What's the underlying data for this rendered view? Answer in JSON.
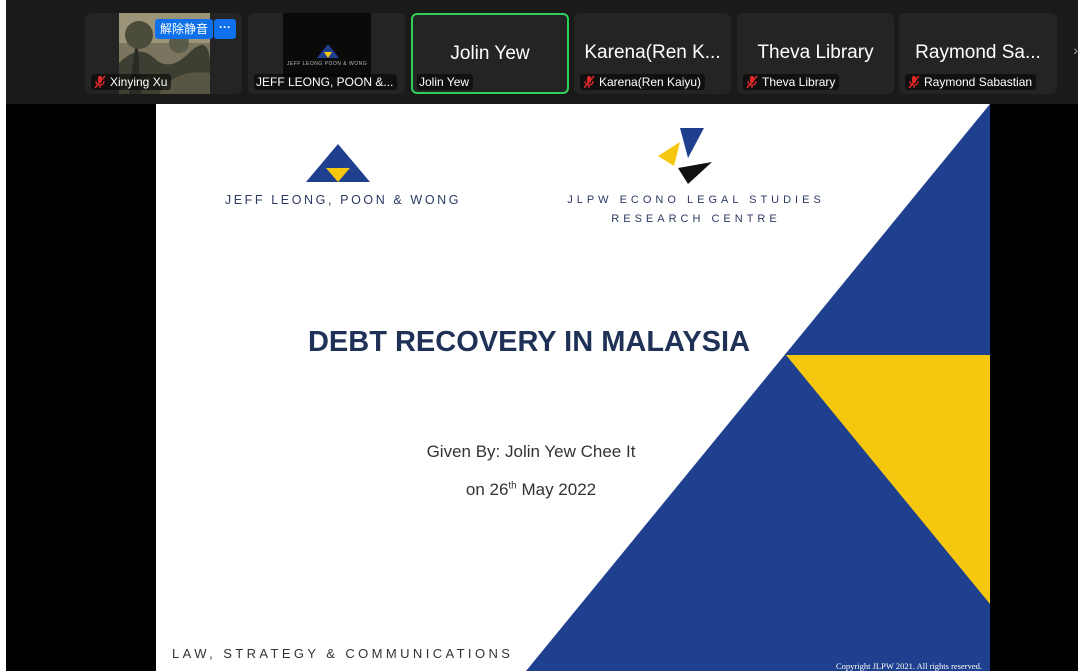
{
  "gallery": {
    "tiles": [
      {
        "name": "Xinying Xu",
        "muted": true,
        "unmute_label": "解除静音",
        "more_label": "···"
      },
      {
        "name": "JEFF LEONG, POON &...",
        "muted": false,
        "thumb_caption": "JEFF LEONG POON & WONG"
      },
      {
        "big_name": "Jolin Yew",
        "name": "Jolin Yew",
        "muted": false,
        "active": true
      },
      {
        "big_name": "Karena(Ren K...",
        "name": "Karena(Ren Kaiyu)",
        "muted": true
      },
      {
        "big_name": "Theva Library",
        "name": "Theva Library",
        "muted": true
      },
      {
        "big_name": "Raymond Sa...",
        "name": "Raymond Sabastian",
        "muted": true
      }
    ]
  },
  "slide": {
    "firm_name": "JEFF LEONG, POON & WONG",
    "centre_line1": "JLPW ECONO LEGAL STUDIES",
    "centre_line2": "RESEARCH CENTRE",
    "title": "DEBT RECOVERY IN MALAYSIA",
    "given_by": "Given By: Jolin Yew Chee It",
    "date_prefix": "on 26",
    "date_sup": "th",
    "date_suffix": " May 2022",
    "footer": "LAW, STRATEGY & COMMUNICATIONS",
    "copyright": "Copyright JLPW 2021. All rights reserved."
  },
  "colors": {
    "navy": "#1f3f8f",
    "yellow": "#f5c80f",
    "active_border": "#2fd05a",
    "zoom_blue": "#0e71eb"
  },
  "icons": [
    "mic-muted-icon",
    "more-icon",
    "jlpw-logo-icon",
    "centre-logo-icon"
  ]
}
